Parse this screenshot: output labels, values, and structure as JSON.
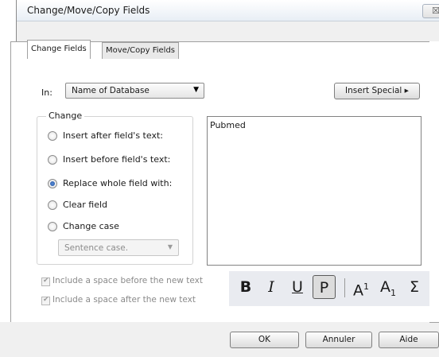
{
  "window": {
    "title": "Change/Move/Copy Fields",
    "close_glyph": "☒"
  },
  "tabs": [
    {
      "label": "Change Fields",
      "active": true
    },
    {
      "label": "Move/Copy Fields",
      "active": false
    }
  ],
  "in_field": {
    "label": "In:",
    "selected": "Name of Database"
  },
  "insert_special": {
    "label": "Insert Special ▸"
  },
  "change_group": {
    "label": "Change",
    "options": [
      {
        "label": "Insert after field's text:",
        "checked": false
      },
      {
        "label": "Insert before field's text:",
        "checked": false
      },
      {
        "label": "Replace whole field with:",
        "checked": true
      },
      {
        "label": "Clear field",
        "checked": false
      },
      {
        "label": "Change case",
        "checked": false
      }
    ],
    "case_select": {
      "selected": "Sentence case."
    }
  },
  "text_area": {
    "value": "Pubmed"
  },
  "checkboxes": [
    {
      "label": "Include a space before the new text",
      "checked": true
    },
    {
      "label": "Include a space after the new text",
      "checked": true
    }
  ],
  "format_toolbar": {
    "bold": "B",
    "italic": "I",
    "underline": "U",
    "plain": "P",
    "superscript_base": "A",
    "superscript_mark": "1",
    "subscript_base": "A",
    "subscript_mark": "1",
    "symbol": "Σ"
  },
  "buttons": {
    "ok": "OK",
    "cancel": "Annuler",
    "help": "Aide"
  },
  "colors": {
    "accent_radio": "#1e4f9e",
    "toolbar_bg": "#e9ebf0"
  }
}
